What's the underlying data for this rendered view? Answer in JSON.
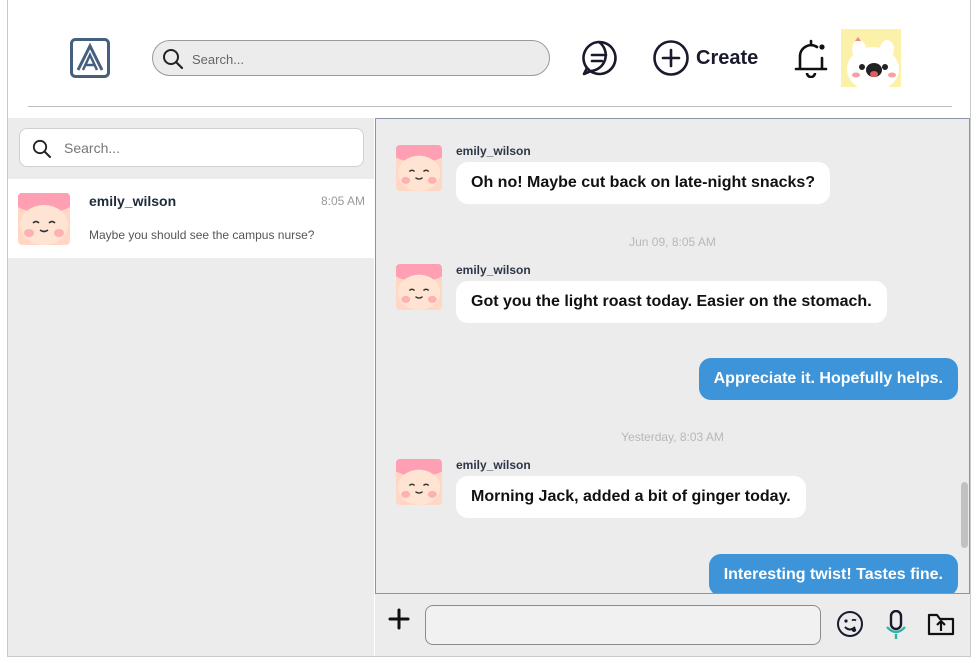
{
  "header": {
    "search_placeholder": "Search...",
    "create_label": "Create",
    "icons": [
      "app-logo-icon",
      "search-icon",
      "messages-icon",
      "plus-circle-icon",
      "bell-icon"
    ]
  },
  "sidebar": {
    "search_placeholder": "Search...",
    "conversations": [
      {
        "name": "emily_wilson",
        "time": "8:05 AM",
        "preview": "Maybe you should see the campus nurse?"
      }
    ]
  },
  "chat": {
    "messages": [
      {
        "direction": "in",
        "sender": "emily_wilson",
        "text": "Oh no! Maybe cut back on late-night snacks?"
      },
      {
        "stamp": "Jun 09, 8:05 AM"
      },
      {
        "direction": "in",
        "sender": "emily_wilson",
        "text": "Got you the light roast today. Easier on the stomach."
      },
      {
        "direction": "out",
        "text": "Appreciate it. Hopefully helps."
      },
      {
        "stamp": "Yesterday, 8:03 AM"
      },
      {
        "direction": "in",
        "sender": "emily_wilson",
        "text": "Morning Jack, added a bit of ginger today."
      },
      {
        "direction": "out",
        "text": "Interesting twist! Tastes fine."
      }
    ]
  },
  "composer": {
    "input_value": "",
    "icons": [
      "plus-icon",
      "emoji-icon",
      "microphone-icon",
      "upload-icon"
    ]
  },
  "colors": {
    "outgoing_bubble": "#3d94d8",
    "panel_background": "#ececec",
    "accent_dark": "#1a1a2e",
    "avatar_pink": "#ff9fb4"
  }
}
